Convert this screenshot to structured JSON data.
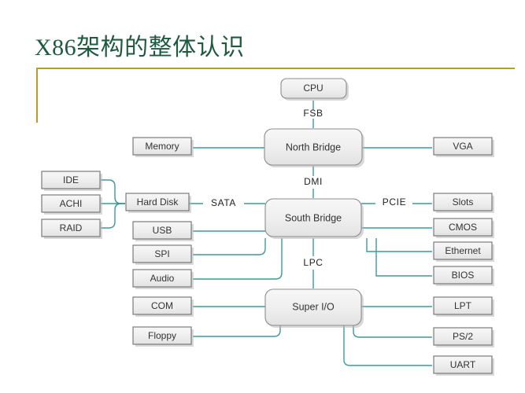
{
  "slide": {
    "title": "X86架构的整体认识",
    "accent_color": "#b79b2b",
    "title_color": "#1d5b3f",
    "wire_color": "#3d9a9c",
    "box_fill": "#ebebeb",
    "box_border": "#6f6f6f"
  },
  "diagram": {
    "type": "block-diagram",
    "nodes": {
      "cpu": "CPU",
      "north_bridge": "North Bridge",
      "south_bridge": "South Bridge",
      "super_io": "Super I/O",
      "memory": "Memory",
      "vga": "VGA",
      "ide": "IDE",
      "achi": "ACHI",
      "raid": "RAID",
      "hard_disk": "Hard Disk",
      "usb": "USB",
      "spi": "SPI",
      "audio": "Audio",
      "slots": "Slots",
      "cmos": "CMOS",
      "ethernet": "Ethernet",
      "bios": "BIOS",
      "com": "COM",
      "floppy": "Floppy",
      "lpt": "LPT",
      "ps2": "PS/2",
      "uart": "UART"
    },
    "bus_labels": {
      "fsb": "FSB",
      "dmi": "DMI",
      "sata": "SATA",
      "pcie": "PCIE",
      "lpc": "LPC"
    }
  }
}
